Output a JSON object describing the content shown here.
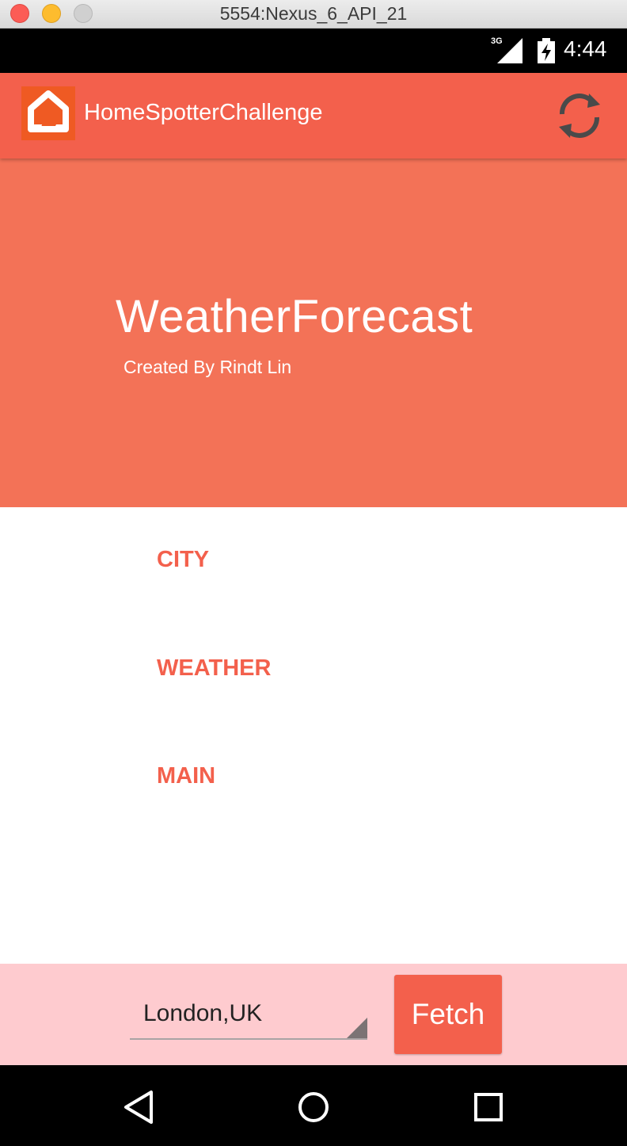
{
  "window": {
    "title": "5554:Nexus_6_API_21"
  },
  "status_bar": {
    "network": "3G",
    "time": "4:44"
  },
  "app_bar": {
    "title": "HomeSpotterChallenge",
    "logo_icon": "home-icon",
    "refresh_icon": "refresh-icon"
  },
  "hero": {
    "title": "WeatherForecast",
    "subtitle": "Created By Rindt Lin"
  },
  "fields": {
    "city_label": "CITY",
    "weather_label": "WEATHER",
    "main_label": "MAIN"
  },
  "fetch_bar": {
    "spinner_value": "London,UK",
    "fetch_label": "Fetch"
  },
  "nav_bar": {
    "icons": [
      "back-icon",
      "home-circle-icon",
      "recent-apps-icon"
    ]
  },
  "colors": {
    "primary": "#f3604c",
    "hero": "#f37257",
    "fetch_bar": "#fecbcf",
    "logo": "#ef5a23"
  }
}
